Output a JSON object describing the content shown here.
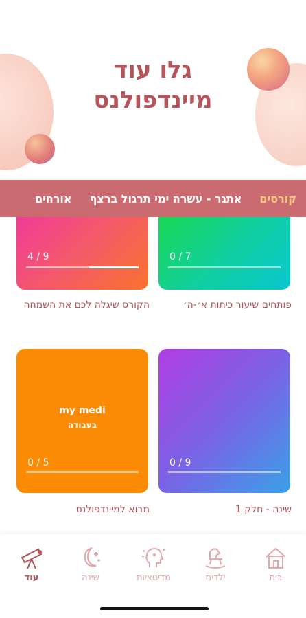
{
  "header": {
    "title_line1": "גלו עוד",
    "title_line2": "מיינדפולנס"
  },
  "categories": [
    {
      "label": "קורסים",
      "active": true
    },
    {
      "label": "אתגר - עשרה ימי תרגול ברצף",
      "active": false
    },
    {
      "label": "אורחים",
      "active": false
    }
  ],
  "cards": [
    {
      "title": "פותחים שיעור כיתות א׳-ה׳",
      "progress_text": "0 / 7",
      "progress_fraction": 0.0
    },
    {
      "title": "הקורס שיגלה לכם את השמחה",
      "progress_text": "4 / 9",
      "progress_fraction": 0.44
    },
    {
      "title": "שינה - חלק 1",
      "progress_text": "0 / 9",
      "progress_fraction": 0.0
    },
    {
      "title": "מבוא למיינדפולנס",
      "progress_text": "0 / 5",
      "progress_fraction": 0.0,
      "overlay_line1": "my medi",
      "overlay_line2": "בעבודה"
    }
  ],
  "nav": [
    {
      "label": "בית",
      "icon": "home-icon",
      "active": false
    },
    {
      "label": "ילדים",
      "icon": "rocking-horse-icon",
      "active": false
    },
    {
      "label": "מדיטציות",
      "icon": "meditation-head-icon",
      "active": false
    },
    {
      "label": "שינה",
      "icon": "moon-stars-icon",
      "active": false
    },
    {
      "label": "עוד",
      "icon": "telescope-icon",
      "active": true
    }
  ],
  "colors": {
    "brand": "#b5545b",
    "category_bar": "#c96b70",
    "category_active": "#f5c97e",
    "nav_inactive": "#e1a9ab"
  }
}
